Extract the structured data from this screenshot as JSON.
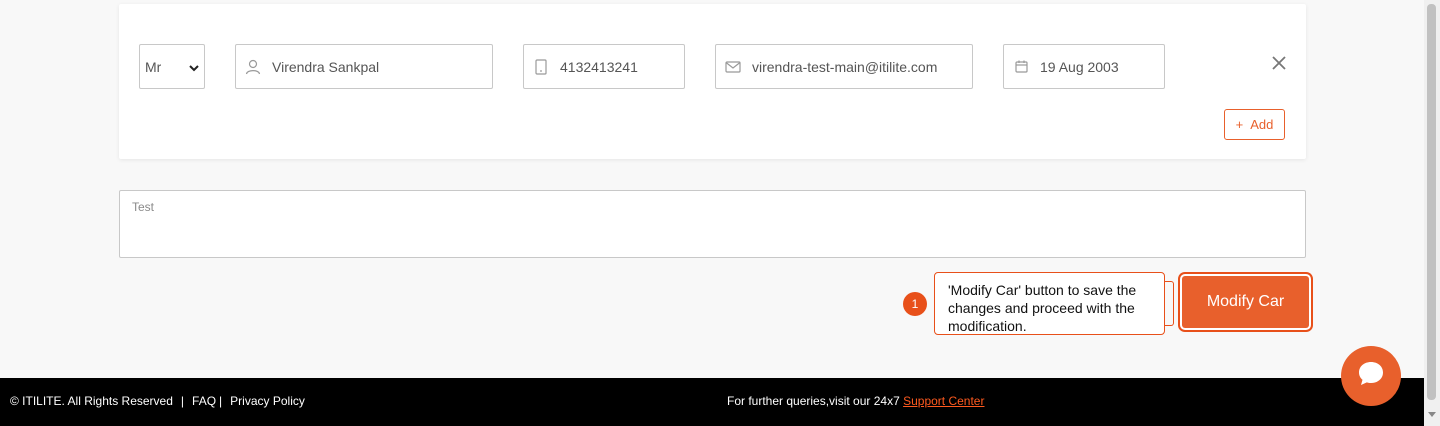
{
  "traveler": {
    "salutation": "Mr",
    "name": "Virendra Sankpal",
    "phone": "4132413241",
    "email": "virendra-test-main@itilite.com",
    "dob": "19 Aug 2003",
    "add_label": "Add"
  },
  "notes": {
    "label": "Test"
  },
  "guide": {
    "step": "1",
    "tooltip": "'Modify Car' button to save the changes and proceed with the modification."
  },
  "actions": {
    "modify_label": "Modify Car"
  },
  "footer": {
    "copyright": "©  ITILITE.  All Rights Reserved",
    "faq": "FAQ",
    "privacy": "Privacy Policy",
    "support_prefix": "For further queries,visit our 24x7",
    "support_link": "Support Center"
  },
  "colors": {
    "accent": "#e8602c",
    "footer_bg": "#000000"
  },
  "icons": [
    "person-icon",
    "phone-icon",
    "mail-icon",
    "calendar-icon",
    "close-icon",
    "chat-icon"
  ]
}
